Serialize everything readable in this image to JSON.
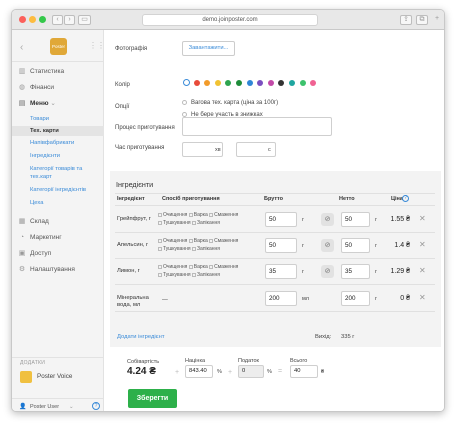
{
  "browser": {
    "url": "demo.joinposter.com"
  },
  "sidebar": {
    "logo": "Poster",
    "items": [
      {
        "label": "Статистика"
      },
      {
        "label": "Фінанси"
      },
      {
        "label": "Меню"
      }
    ],
    "menu_sub": [
      {
        "label": "Товари"
      },
      {
        "label": "Тех. карти"
      },
      {
        "label": "Напівфабрикати"
      },
      {
        "label": "Інгредієнти"
      },
      {
        "label": "Категорії товарів та тех.карт"
      },
      {
        "label": "Категорії інгредієнтів"
      },
      {
        "label": "Цеха"
      }
    ],
    "items2": [
      {
        "label": "Склад"
      },
      {
        "label": "Маркетинг"
      },
      {
        "label": "Доступ"
      },
      {
        "label": "Налаштування"
      }
    ],
    "addons_title": "ДОДАТКИ",
    "addon": "Poster Voice",
    "user": "Poster User"
  },
  "form": {
    "photo_label": "Фотографія",
    "photo_button": "Завантажити...",
    "color_label": "Колір",
    "colors": [
      "#ffffff",
      "#e84b3a",
      "#f29b2a",
      "#f1c232",
      "#2ea44f",
      "#1e8c3a",
      "#2f86d6",
      "#7a4fbf",
      "#c24aa8",
      "#333333",
      "#1fa6a0",
      "#3cc26d",
      "#f06292"
    ],
    "options_label": "Опції",
    "option1": "Вагова тех. карта (ціна за 100г)",
    "option2": "Не бере участь в знижках",
    "process_label": "Процес приготування",
    "time_label": "Час приготування",
    "time_unit_min": "хв",
    "time_unit_sec": "с"
  },
  "ingredients": {
    "title": "Інгредієнти",
    "headers": {
      "ingredient": "Інгредієнт",
      "method": "Спосіб приготування",
      "gross": "Брутто",
      "net": "Нетто",
      "price": "Ціна"
    },
    "methods": {
      "clean": "Очищення",
      "boil": "Варка",
      "fry": "Смаження",
      "stew": "Тушкування",
      "bake": "Запікання"
    },
    "rows": [
      {
        "name": "Грейпфрут, г",
        "gross": "50",
        "gross_unit": "г",
        "net": "50",
        "net_unit": "г",
        "price": "1.55 ₴"
      },
      {
        "name": "Апельсин, г",
        "gross": "50",
        "gross_unit": "г",
        "net": "50",
        "net_unit": "г",
        "price": "1.4 ₴"
      },
      {
        "name": "Лимон, г",
        "gross": "35",
        "gross_unit": "г",
        "net": "35",
        "net_unit": "г",
        "price": "1.29 ₴"
      },
      {
        "name": "Мінеральна вода, мл",
        "method": "—",
        "gross": "200",
        "gross_unit": "мл",
        "net": "200",
        "net_unit": "г",
        "price": "0 ₴"
      }
    ],
    "add_link": "Додати інгредієнт",
    "output_label": "Вихід:",
    "output_value": "335 г"
  },
  "totals": {
    "cost_label": "Собівартість",
    "cost_value": "4.24 ₴",
    "markup_label": "Націнка",
    "markup_value": "843.40",
    "markup_unit": "%",
    "tax_label": "Податок",
    "tax_value": "0",
    "tax_unit": "%",
    "total_label": "Всього",
    "total_value": "40",
    "total_unit": "₴"
  },
  "save_button": "Зберегти"
}
